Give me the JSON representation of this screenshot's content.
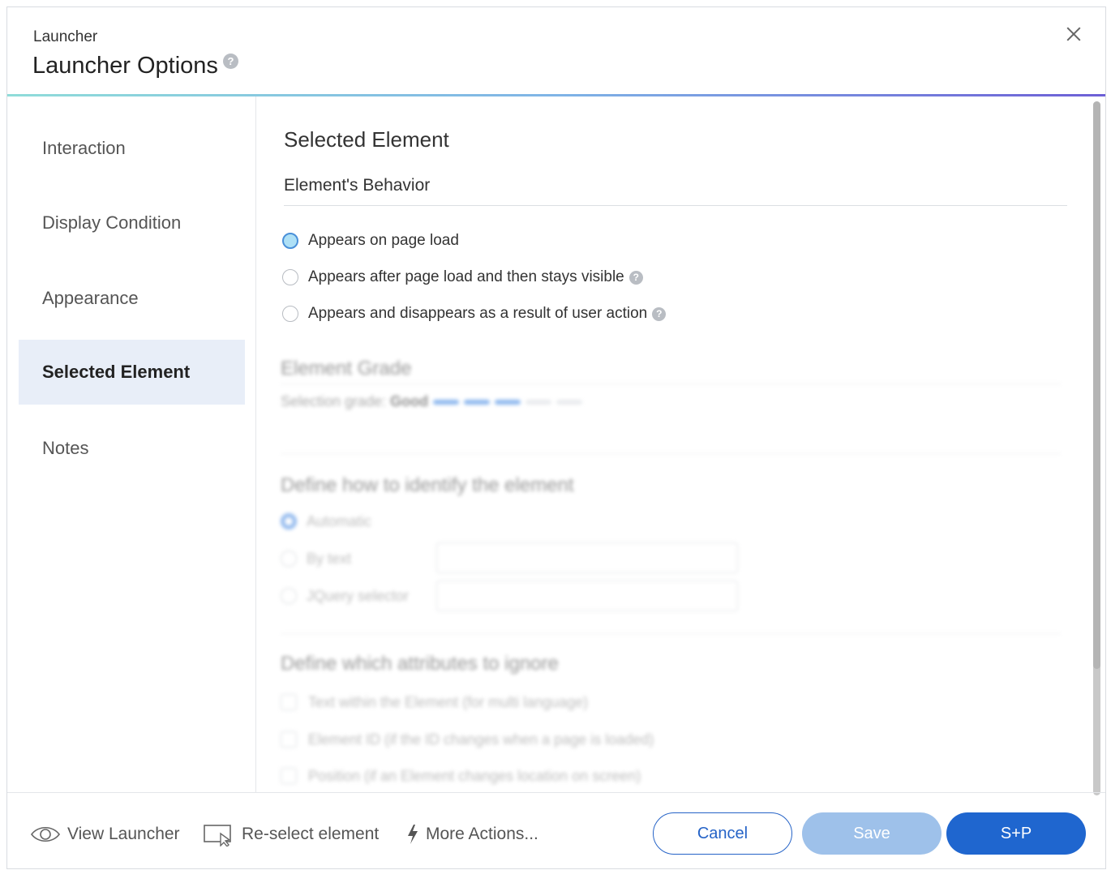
{
  "header": {
    "subtitle": "Launcher",
    "title": "Launcher Options",
    "help_glyph": "?"
  },
  "sidebar": {
    "items": [
      {
        "label": "Interaction"
      },
      {
        "label": "Display Condition"
      },
      {
        "label": "Appearance"
      },
      {
        "label": "Selected Element",
        "active": true
      },
      {
        "label": "Notes"
      }
    ]
  },
  "main": {
    "section_title": "Selected Element",
    "behavior_label": "Element's Behavior",
    "behavior_options": [
      {
        "label": "Appears on page load",
        "checked": true
      },
      {
        "label": "Appears after page load and then stays visible",
        "help": true
      },
      {
        "label": "Appears and disappears as a result of user action",
        "help": true
      }
    ],
    "grade": {
      "title": "Element Grade",
      "label": "Selection grade:",
      "value": "Good",
      "level": 3,
      "max_level": 5
    },
    "identify": {
      "title": "Define how to identify the element",
      "options": [
        {
          "label": "Automatic",
          "checked": true
        },
        {
          "label": "By text"
        },
        {
          "label": "JQuery selector"
        }
      ]
    },
    "ignore": {
      "title": "Define which attributes to ignore",
      "options": [
        {
          "label": "Text within the Element (for multi language)"
        },
        {
          "label": "Element ID (if the ID changes when a page is loaded)"
        },
        {
          "label": "Position (if an Element changes location on screen)"
        }
      ]
    }
  },
  "footer": {
    "view_launcher": "View Launcher",
    "reselect": "Re-select element",
    "more_actions": "More Actions...",
    "cancel": "Cancel",
    "save": "Save",
    "save_publish": "S+P"
  },
  "colors": {
    "accent": "#1f66cf",
    "save_disabled": "#9ec1ea",
    "active_nav_bg": "#e8eef8",
    "radio_selected": "#4a90d9"
  }
}
